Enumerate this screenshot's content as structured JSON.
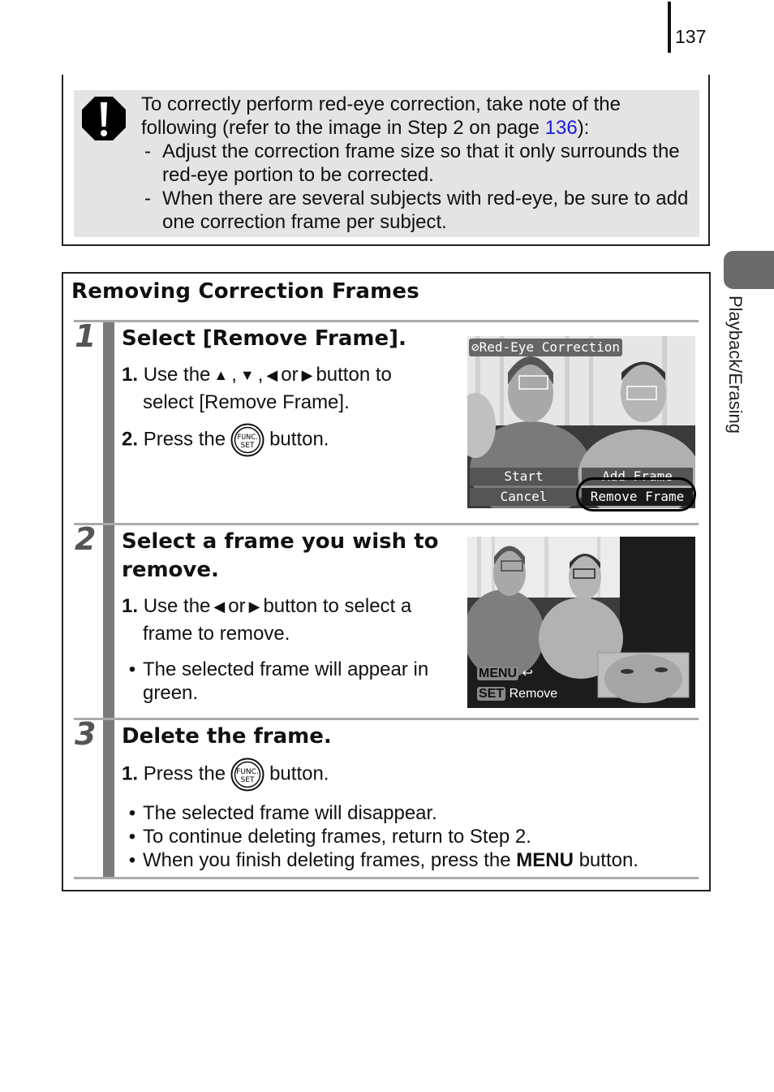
{
  "page": {
    "number": "137",
    "side_tab_label": "Playback/Erasing"
  },
  "caution": {
    "icon": "caution-exclamation-icon",
    "intro_pre": "To correctly perform red-eye correction, take note of the following (refer to the image in Step 2 on page ",
    "intro_link": "136",
    "intro_post": "):",
    "items": [
      {
        "dash": "-",
        "text": "Adjust the correction frame size so that it only surrounds the red-eye portion to be corrected."
      },
      {
        "dash": "-",
        "text": "When there are several subjects with red-eye, be sure to add one correction frame per subject."
      }
    ]
  },
  "section": {
    "title": "Removing Correction Frames"
  },
  "steps": [
    {
      "number": "1",
      "title": "Select [Remove Frame].",
      "item1_num": "1.",
      "item1_pre": "Use the",
      "item1_sep1": ",",
      "item1_sep2": ",",
      "item1_or": "or",
      "item1_post": "button to",
      "item1_line2": "select [Remove Frame].",
      "item2_num": "2.",
      "item2_pre": "Press the",
      "item2_post": "button.",
      "screen": {
        "title": "Red-Eye Correction",
        "menu": [
          "Start",
          "Add Frame",
          "Cancel",
          "Remove Frame"
        ],
        "selected": "Remove Frame"
      }
    },
    {
      "number": "2",
      "title_line1": "Select a frame you wish to",
      "title_line2": "remove.",
      "item1_num": "1.",
      "item1_pre": "Use the",
      "item1_or": "or",
      "item1_post": "button to select a",
      "item1_line2": "frame to remove.",
      "bullet_line1": "The selected frame will appear in",
      "bullet_line2": "green.",
      "screen": {
        "menu_key": "MENU",
        "set_key": "SET",
        "set_label": "Remove"
      }
    },
    {
      "number": "3",
      "title": "Delete the frame.",
      "item1_num": "1.",
      "item1_pre": "Press the",
      "item1_post": "button.",
      "bullets": [
        "The selected frame will disappear.",
        "To continue deleting frames, return to Step 2."
      ],
      "bullet3_pre": "When you finish deleting frames, press the ",
      "bullet3_bold": "MENU",
      "bullet3_post": " button."
    }
  ],
  "func_button": {
    "line1": "FUNC.",
    "line2": "SET"
  },
  "bullet_char": "•",
  "arrows": {
    "up": "▲",
    "down": "▼",
    "left": "◀",
    "right": "▶"
  }
}
